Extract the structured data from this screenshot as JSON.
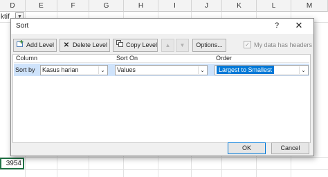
{
  "sheet": {
    "columns": [
      "D",
      "E",
      "F",
      "G",
      "H",
      "I",
      "J",
      "K",
      "L",
      "M"
    ],
    "header_cell_partial": "ktif",
    "selected_cell_value": "3954"
  },
  "dialog": {
    "title": "Sort",
    "help_glyph": "?",
    "close_glyph": "✕",
    "toolbar": {
      "add_level": "Add Level",
      "delete_level": "Delete Level",
      "copy_level": "Copy Level",
      "move_up_glyph": "▲",
      "move_down_glyph": "▼",
      "options": "Options...",
      "my_data_has_headers": "My data has headers",
      "headers_checked": true
    },
    "grid": {
      "headers": [
        "Column",
        "Sort On",
        "Order"
      ],
      "rows": [
        {
          "label": "Sort by",
          "column": "Kasus harian",
          "sort_on": "Values",
          "order": "Largest to Smallest"
        }
      ]
    },
    "buttons": {
      "ok": "OK",
      "cancel": "Cancel"
    }
  },
  "colors": {
    "accent": "#0078d7",
    "excel_green": "#217346",
    "selection_row": "#cfe3fb"
  }
}
